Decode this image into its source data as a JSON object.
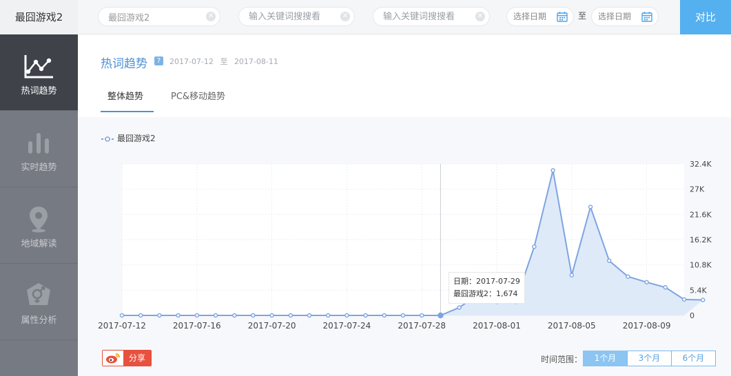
{
  "top": {
    "app_title": "最囧游戏2",
    "search1_value": "最囧游戏2",
    "search2_placeholder": "输入关键词搜搜看",
    "search3_placeholder": "输入关键词搜搜看",
    "date_start_placeholder": "选择日期",
    "to_label": "至",
    "date_end_placeholder": "选择日期",
    "compare_label": "对比"
  },
  "sidebar": {
    "items": [
      {
        "label": "热词趋势",
        "icon": "trend-chart-icon",
        "active": true
      },
      {
        "label": "实时趋势",
        "icon": "bar-chart-icon",
        "active": false
      },
      {
        "label": "地域解读",
        "icon": "location-pin-icon",
        "active": false
      },
      {
        "label": "属性分析",
        "icon": "gender-icon",
        "active": false
      }
    ]
  },
  "main": {
    "title": "热词趋势",
    "help_label": "?",
    "date_from": "2017-07-12",
    "date_sep": "至",
    "date_to": "2017-08-11",
    "tabs": [
      {
        "label": "整体趋势",
        "active": true
      },
      {
        "label": "PC&移动趋势",
        "active": false
      }
    ],
    "tooltip": {
      "date_label": "日期：",
      "date_value": "2017-07-29",
      "series_label": "最囧游戏2：",
      "series_value": "1,674"
    },
    "share_label": "分享",
    "range_label": "时间范围：",
    "ranges": [
      {
        "label": "1个月",
        "active": true
      },
      {
        "label": "3个月",
        "active": false
      },
      {
        "label": "6个月",
        "active": false
      }
    ]
  },
  "colors": {
    "accent": "#4a8fd8",
    "line": "#7da4e0",
    "fill": "#dce8f8",
    "sidebar_bg": "#767a82",
    "sidebar_active": "#3f4249",
    "compare": "#55b0ef",
    "share_red": "#e8513f"
  },
  "chart_data": {
    "type": "area",
    "series": [
      {
        "name": "最囧游戏2",
        "values": [
          0,
          0,
          0,
          0,
          0,
          0,
          0,
          0,
          0,
          0,
          0,
          0,
          0,
          0,
          0,
          0,
          0,
          0,
          1674,
          4500,
          2900,
          2900,
          14700,
          31000,
          8600,
          23200,
          11700,
          8300,
          7100,
          6000,
          3400,
          3300
        ]
      }
    ],
    "x": [
      "2017-07-12",
      "2017-07-13",
      "2017-07-14",
      "2017-07-15",
      "2017-07-16",
      "2017-07-17",
      "2017-07-18",
      "2017-07-19",
      "2017-07-20",
      "2017-07-21",
      "2017-07-22",
      "2017-07-23",
      "2017-07-24",
      "2017-07-25",
      "2017-07-26",
      "2017-07-27",
      "2017-07-28",
      "2017-07-29",
      "2017-07-30",
      "2017-07-31",
      "2017-08-01",
      "2017-08-02",
      "2017-08-03",
      "2017-08-04",
      "2017-08-05",
      "2017-08-06",
      "2017-08-07",
      "2017-08-08",
      "2017-08-09",
      "2017-08-10",
      "2017-08-11"
    ],
    "x_tick_labels": [
      "2017-07-12",
      "2017-07-16",
      "2017-07-20",
      "2017-07-24",
      "2017-07-28",
      "2017-08-01",
      "2017-08-05",
      "2017-08-09"
    ],
    "y_tick_labels": [
      "0",
      "5.4K",
      "10.8K",
      "16.2K",
      "21.6K",
      "27K",
      "32.4K"
    ],
    "ylim": [
      0,
      32400
    ],
    "y_axis_position": "right",
    "grid": true,
    "legend": "top-left",
    "legend_label": "最囧游戏2"
  }
}
